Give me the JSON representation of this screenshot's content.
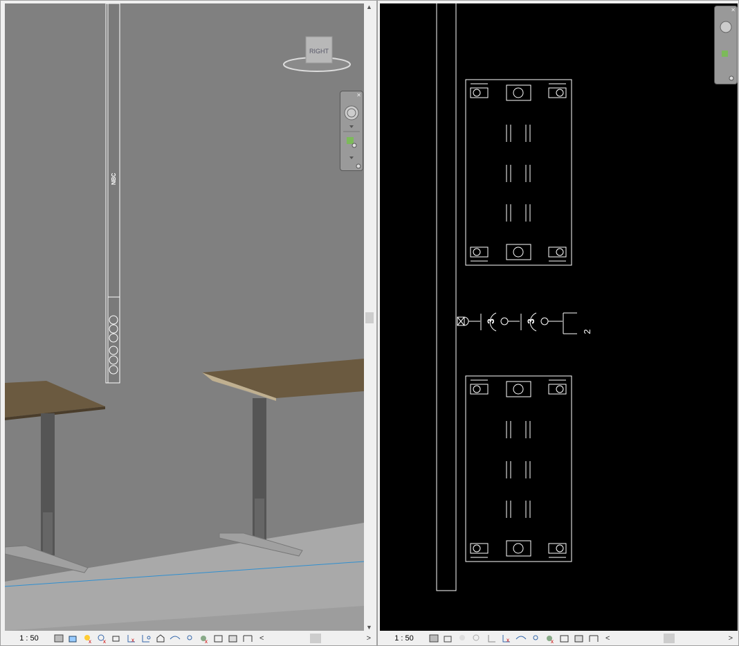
{
  "left_view": {
    "view_cube_label": "RIGHT",
    "panel_label": "NBC",
    "scale": "1 : 50",
    "status_icons": [
      "detail-level-icon",
      "visual-style-icon",
      "sun-path-off-icon",
      "shadows-off-icon",
      "render-icon",
      "crop-view-icon",
      "show-crop-icon",
      "unlock-3d-icon",
      "temporary-hide-icon",
      "reveal-hidden-icon",
      "worksharing-display-icon",
      "temporary-view-properties-icon",
      "hide-analytical-icon",
      "highlight-displacement-icon"
    ]
  },
  "right_view": {
    "scale": "1 : 50",
    "circuit_tags": [
      "3",
      "3",
      "2"
    ],
    "status_icons": [
      "detail-level-icon",
      "visual-style-icon",
      "sun-path-off-icon",
      "shadows-off-icon",
      "crop-view-icon",
      "show-crop-icon",
      "temporary-hide-icon",
      "reveal-hidden-icon",
      "worksharing-display-icon",
      "temporary-view-properties-icon",
      "hide-analytical-icon",
      "highlight-displacement-icon"
    ]
  },
  "colors": {
    "wall": "#808080",
    "floor": "#a8a8a8",
    "desk_top": "#6b5a40",
    "plan_bg": "#000000",
    "grid_line": "#2f8fd0"
  }
}
